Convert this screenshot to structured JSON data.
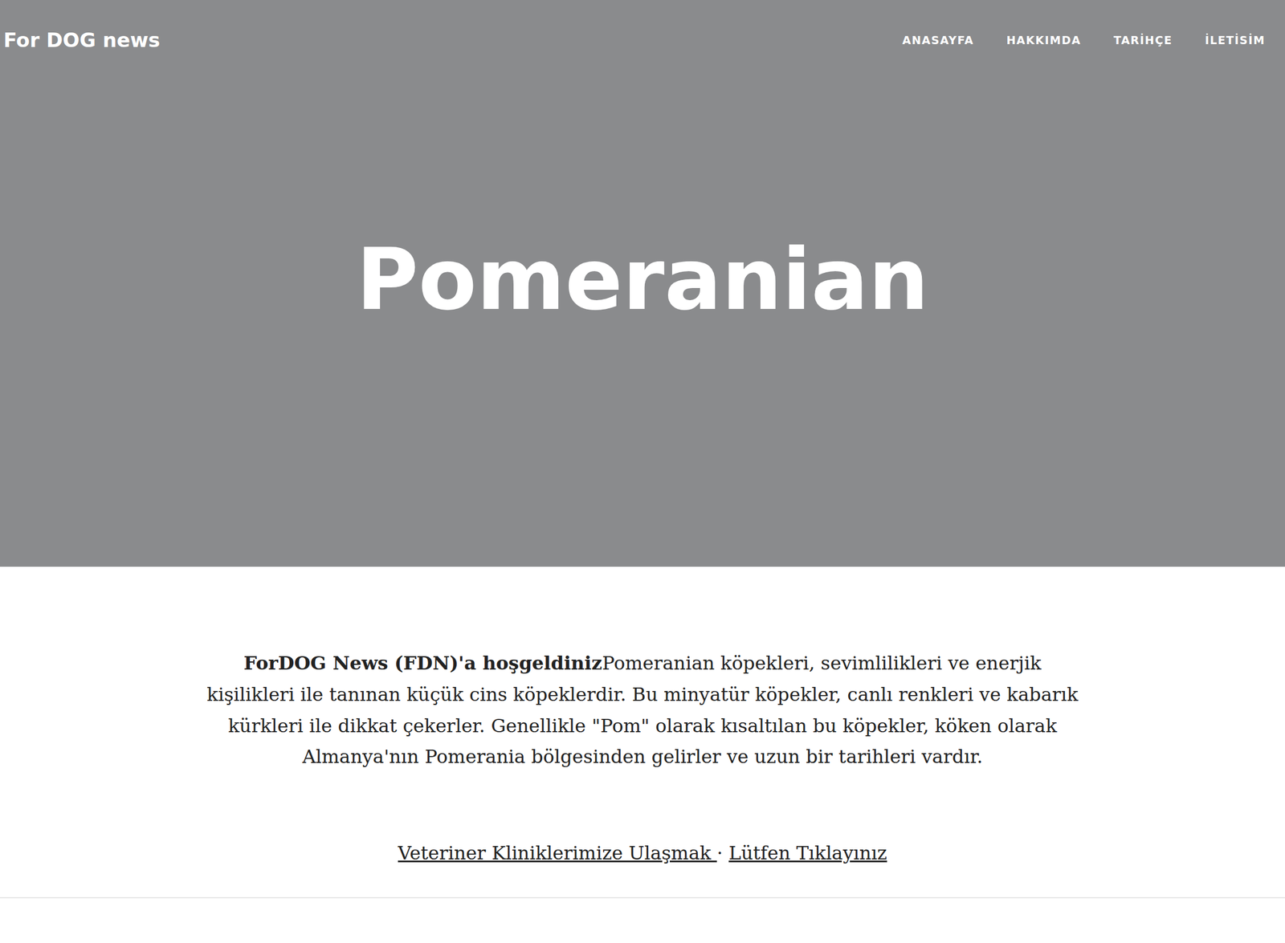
{
  "navbar": {
    "brand": "For DOG news",
    "links": [
      "ANASAYFA",
      "HAKKIMDA",
      "TARİHÇE",
      "İLETİSİM"
    ]
  },
  "hero": {
    "title": "Pomeranian"
  },
  "intro": {
    "bold": "ForDOG News (FDN)'a hoşgeldiniz",
    "text": "Pomeranian köpekleri, sevimlilikleri ve enerjik kişilikleri ile tanınan küçük cins köpeklerdir. Bu minyatür köpekler, canlı renkleri ve kabarık kürkleri ile dikkat çekerler. Genellikle \"Pom\" olarak kısaltılan bu köpekler, köken olarak Almanya'nın Pomerania bölgesinden gelirler ve uzun bir tarihleri vardır."
  },
  "links": {
    "first": "Veteriner Kliniklerimize Ulaşmak ",
    "separator": " · ",
    "second": "Lütfen Tıklayınız"
  }
}
